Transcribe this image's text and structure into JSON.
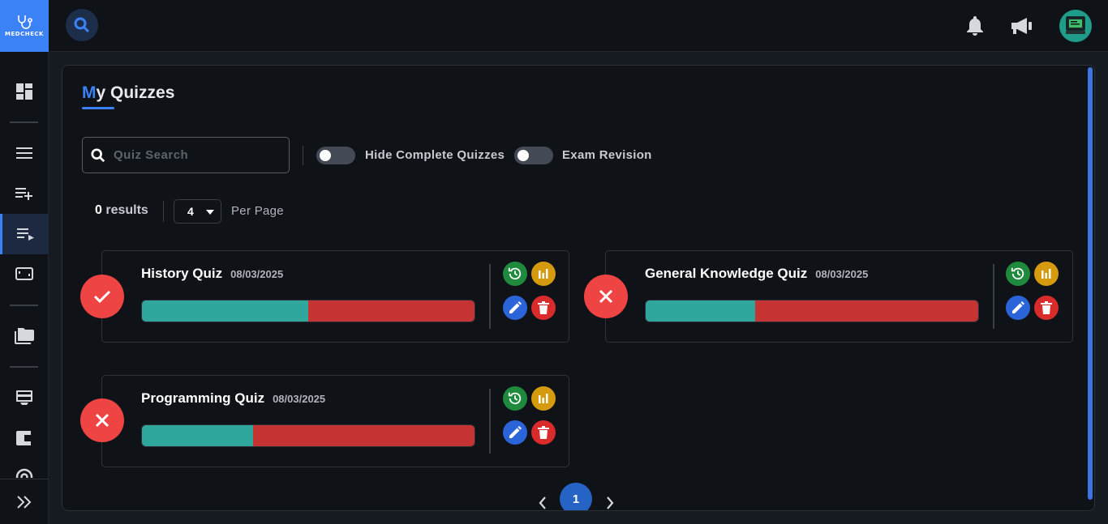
{
  "app": {
    "logo_text": "MEDCHECK",
    "colors": {
      "accent": "#3b82f6",
      "success": "#ef4444",
      "pass": "#ef4444",
      "progress_correct": "#2fa79c",
      "progress_incorrect": "#c53333"
    }
  },
  "sidebar": {
    "items": [
      {
        "icon": "dashboard-icon"
      },
      {
        "icon": "menu-icon"
      },
      {
        "icon": "playlist-add-icon"
      },
      {
        "icon": "playlist-play-icon",
        "active": true
      },
      {
        "icon": "tv-icon"
      },
      {
        "icon": "folder-icon"
      },
      {
        "icon": "card-icon"
      },
      {
        "icon": "wallet-icon"
      },
      {
        "icon": "support-icon"
      }
    ],
    "expand_icon": "double-chevron-right-icon"
  },
  "topbar": {
    "search_icon": "search-icon",
    "notifications_icon": "bell-icon",
    "announcements_icon": "megaphone-icon",
    "avatar_icon": "avatar"
  },
  "page": {
    "title_first": "M",
    "title_rest": "y Quizzes",
    "search_placeholder": "Quiz Search",
    "search_value": "",
    "toggle_hide_complete": "Hide Complete Quizzes",
    "toggle_exam_revision": "Exam Revision",
    "results_count": "0",
    "results_label": "results",
    "per_page_value": "4",
    "per_page_label": "Per Page",
    "current_page": "1"
  },
  "quizzes": [
    {
      "title": "History Quiz",
      "date": "08/03/2025",
      "status": "passed",
      "status_icon": "check-icon",
      "correct_fraction": 0.5
    },
    {
      "title": "General Knowledge Quiz",
      "date": "08/03/2025",
      "status": "failed",
      "status_icon": "close-icon",
      "correct_fraction": 0.33
    },
    {
      "title": "Programming Quiz",
      "date": "08/03/2025",
      "status": "failed",
      "status_icon": "close-icon",
      "correct_fraction": 0.335
    }
  ]
}
